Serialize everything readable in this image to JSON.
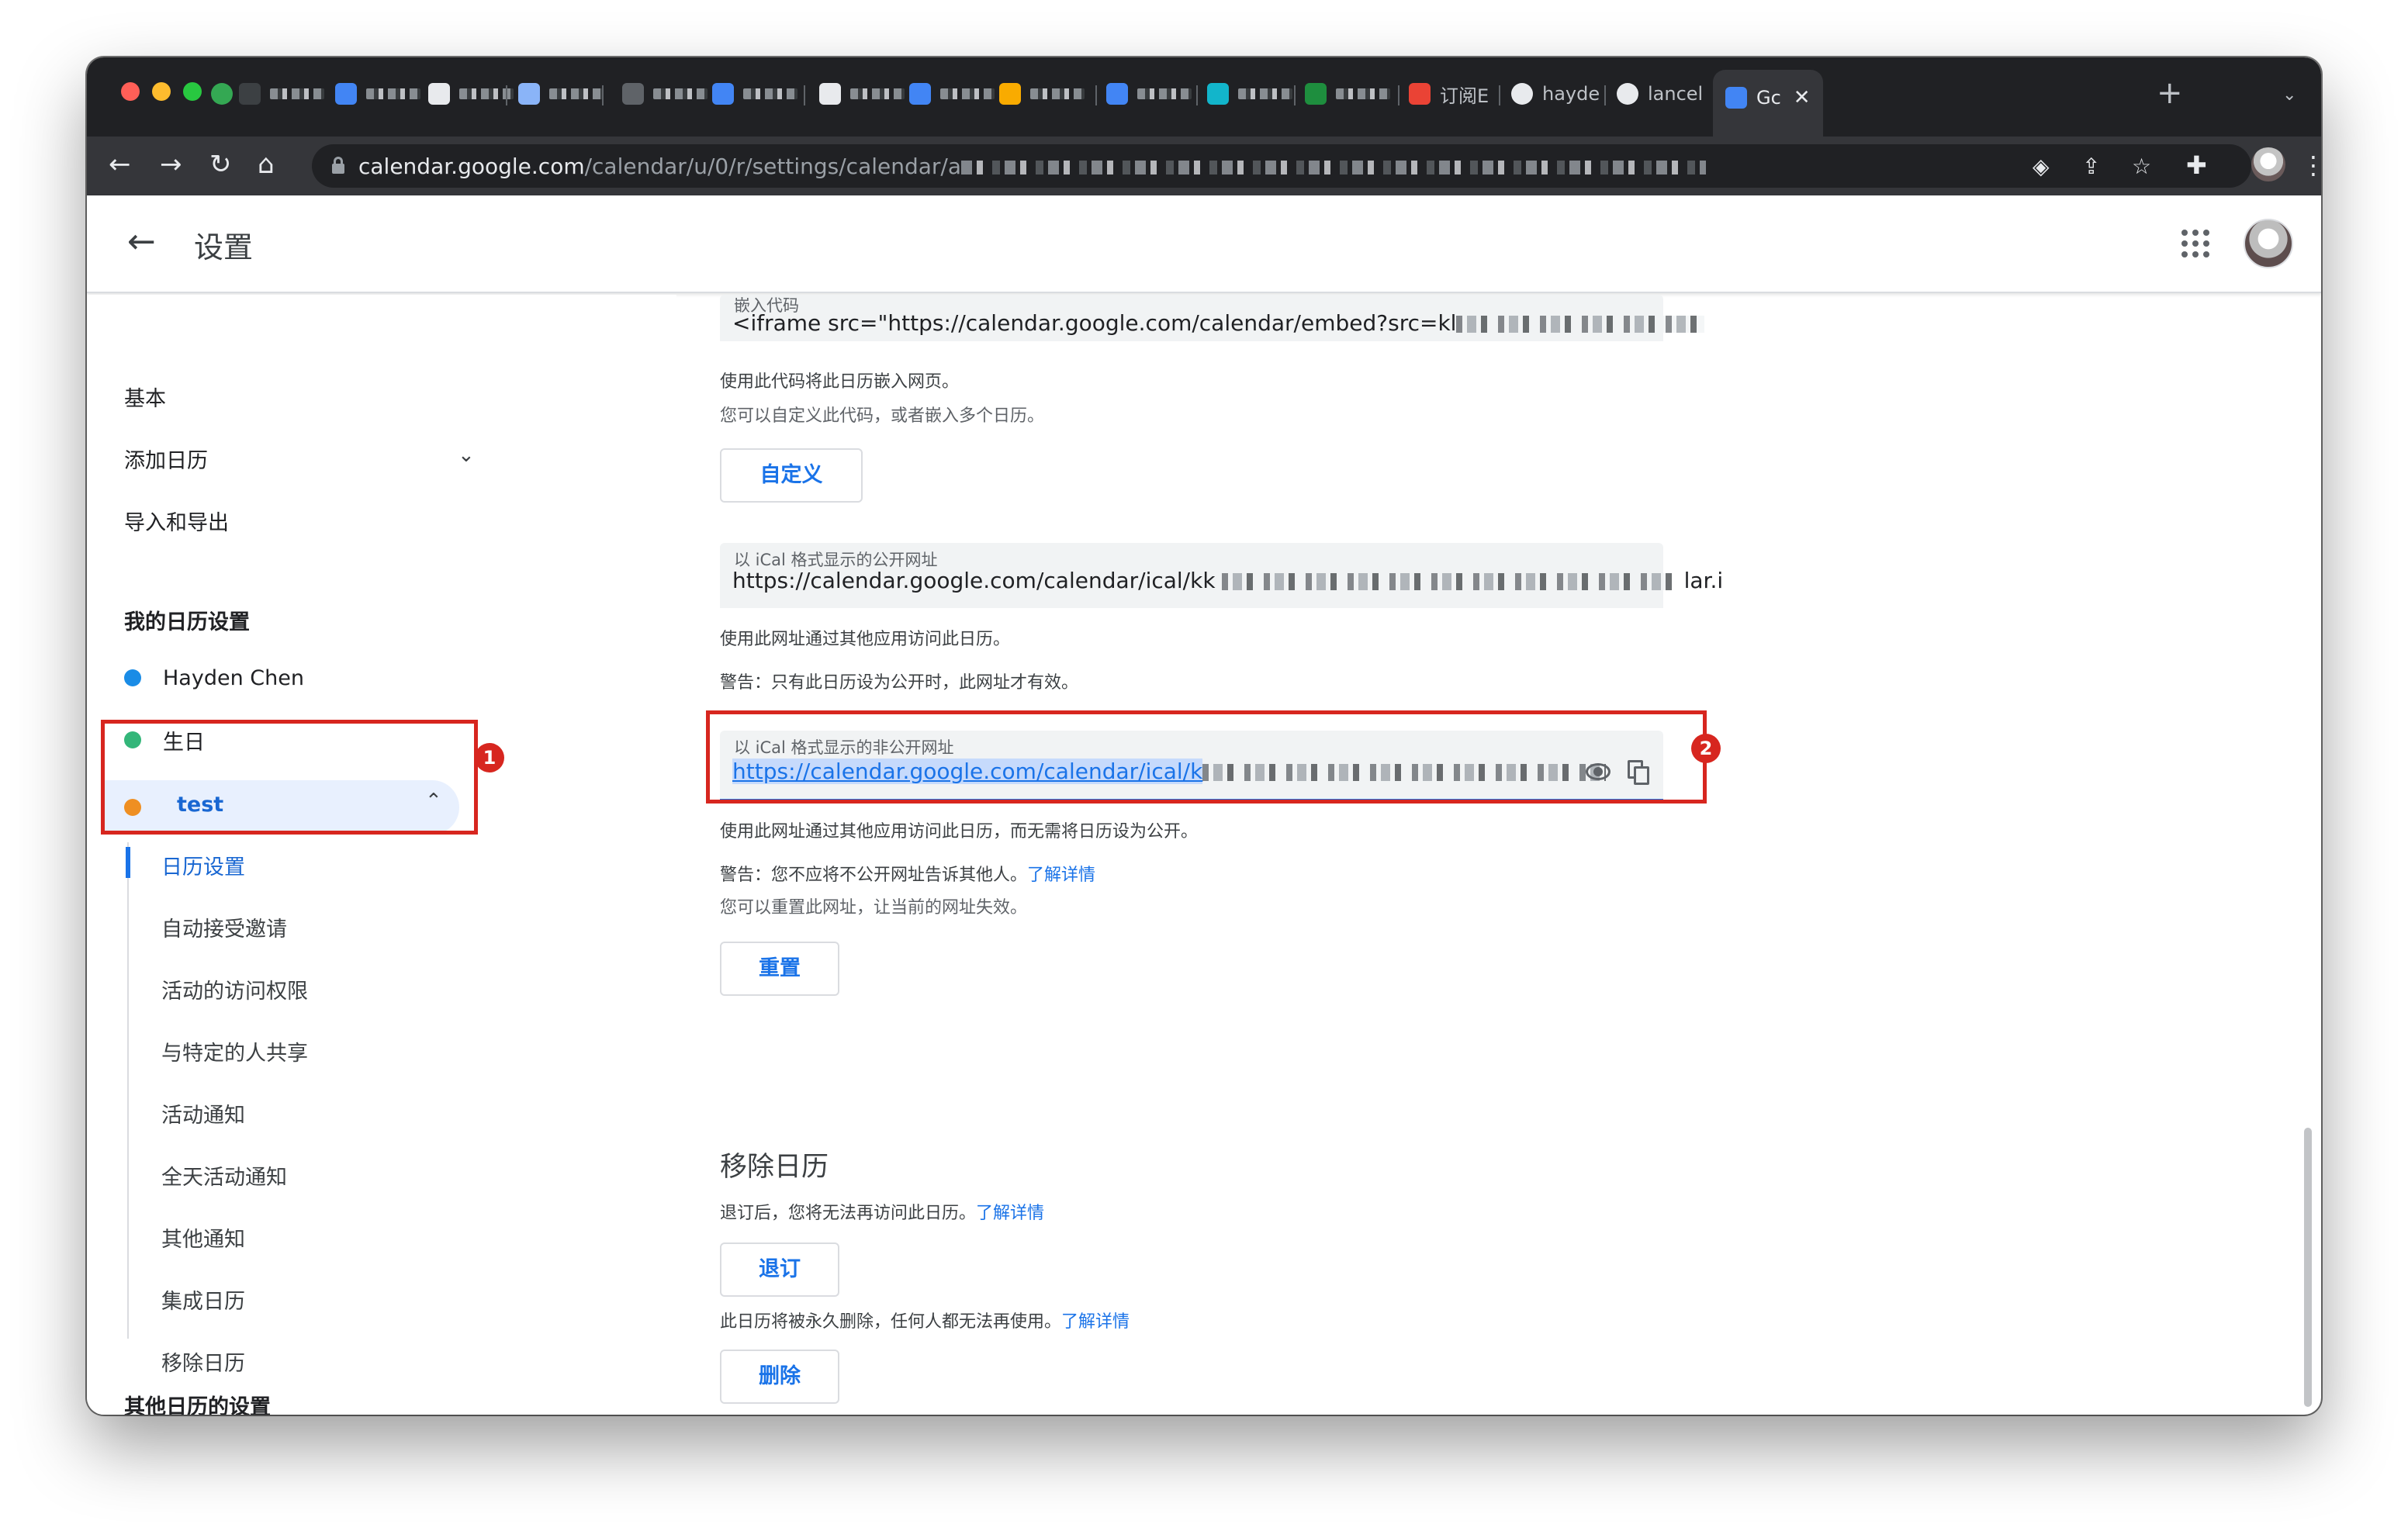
{
  "browser": {
    "tabs": [
      {
        "label": "订阅E"
      },
      {
        "label": "hayde"
      },
      {
        "label": "lancel"
      },
      {
        "label": "Gc"
      }
    ],
    "url_host": "calendar.google.com",
    "url_path": "/calendar/u/0/r/settings/calendar/a"
  },
  "header": {
    "title": "设置"
  },
  "sidebar": {
    "nav": {
      "basic": "基本",
      "add_calendar": "添加日历",
      "import_export": "导入和导出"
    },
    "my_calendars_heading": "我的日历设置",
    "calendars": [
      {
        "name": "Hayden Chen",
        "color": "#1a8ce6"
      },
      {
        "name": "生日",
        "color": "#33b679"
      },
      {
        "name": "test",
        "color": "#ef8f22"
      }
    ],
    "sub_items": [
      "日历设置",
      "自动接受邀请",
      "活动的访问权限",
      "与特定的人共享",
      "活动通知",
      "全天活动通知",
      "其他通知",
      "集成日历",
      "移除日历"
    ],
    "other_calendars_heading": "其他日历的设置"
  },
  "main": {
    "embed": {
      "label": "嵌入代码",
      "value": "<iframe src=\"https://calendar.google.com/calendar/embed?src=kl"
    },
    "embed_desc": "使用此代码将此日历嵌入网页。",
    "embed_sub": "您可以自定义此代码，或者嵌入多个日历。",
    "customize_button": "自定义",
    "public_ical": {
      "label": "以 iCal 格式显示的公开网址",
      "value": "https://calendar.google.com/calendar/ical/kk",
      "tail": "lar.i"
    },
    "public_desc": "使用此网址通过其他应用访问此日历。",
    "public_warning": "警告：只有此日历设为公开时，此网址才有效。",
    "secret_ical": {
      "label": "以 iCal 格式显示的非公开网址",
      "value": "https://calendar.google.com/calendar/ical/k"
    },
    "secret_desc": "使用此网址通过其他应用访问此日历，而无需将日历设为公开。",
    "secret_warning": "警告：您不应将不公开网址告诉其他人。",
    "learn_more": "了解详情",
    "secret_reset_desc": "您可以重置此网址，让当前的网址失效。",
    "reset_button": "重置",
    "remove_title": "移除日历",
    "unsubscribe_desc": "退订后，您将无法再访问此日历。",
    "unsubscribe_button": "退订",
    "delete_desc": "此日历将被永久删除，任何人都无法再使用。",
    "delete_button": "删除"
  },
  "annotations": {
    "badge1": "1",
    "badge2": "2"
  }
}
